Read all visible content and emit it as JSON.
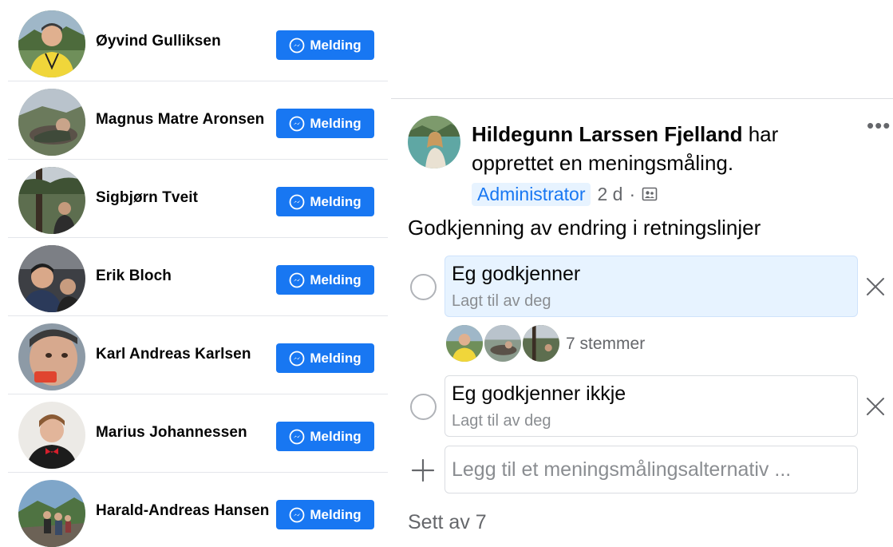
{
  "members": [
    {
      "name": "Øyvind Gulliksen",
      "button_label": "Melding",
      "avatar_icon": "person-photo"
    },
    {
      "name": "Magnus Matre Aronsen",
      "button_label": "Melding",
      "avatar_icon": "person-photo"
    },
    {
      "name": "Sigbjørn Tveit",
      "button_label": "Melding",
      "avatar_icon": "person-photo"
    },
    {
      "name": "Erik Bloch",
      "button_label": "Melding",
      "avatar_icon": "person-photo"
    },
    {
      "name": "Karl Andreas Karlsen",
      "button_label": "Melding",
      "avatar_icon": "person-photo"
    },
    {
      "name": "Marius Johannessen",
      "button_label": "Melding",
      "avatar_icon": "person-photo"
    },
    {
      "name": "Harald-Andreas Hansen",
      "button_label": "Melding",
      "avatar_icon": "person-photo"
    }
  ],
  "message_button_icon": "messenger-icon",
  "post": {
    "author": "Hildegunn Larssen Fjelland",
    "action_text": " har opprettet en meningsmåling.",
    "role_badge": "Administrator",
    "time": "2 d",
    "separator": "·",
    "privacy_icon": "group-members-icon",
    "more_label": "•••",
    "question": "Godkjenning av endring i retningslinjer",
    "options": [
      {
        "title": "Eg godkjenner",
        "subtitle": "Lagt til av deg",
        "selected": true
      },
      {
        "title": "Eg godkjenner ikkje",
        "subtitle": "Lagt til av deg",
        "selected": false
      }
    ],
    "votes_text": "7 stemmer",
    "add_option_placeholder": "Legg til et meningsmålingsalternativ ...",
    "seen_by": "Sett av 7"
  },
  "colors": {
    "accent": "#1877f2",
    "badge_bg": "#e7f3ff",
    "secondary_text": "#65676b",
    "divider": "#e4e6eb"
  }
}
